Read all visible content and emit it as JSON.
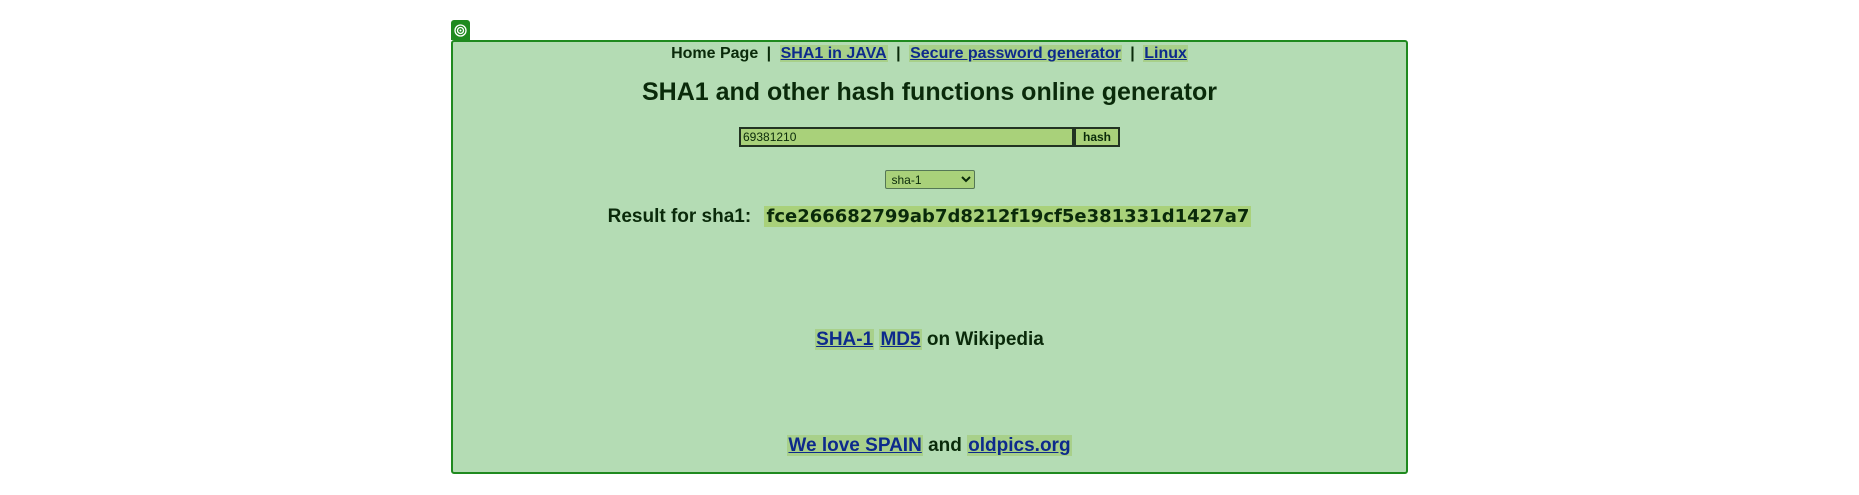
{
  "nav": {
    "home": "Home Page",
    "separator": "|",
    "links": [
      "SHA1 in JAVA",
      "Secure password generator",
      "Linux"
    ]
  },
  "title": "SHA1 and other hash functions online generator",
  "form": {
    "input_value": "69381210",
    "button_label": "hash",
    "algorithm_selected": "sha-1"
  },
  "result": {
    "label": "Result for sha1:",
    "hash": "fce266682799ab7d8212f19cf5e381331d1427a7"
  },
  "wiki": {
    "link1": "SHA-1",
    "link2": "MD5",
    "suffix": "on Wikipedia"
  },
  "footer": {
    "link1": "We love SPAIN",
    "conj": "and",
    "link2": "oldpics.org"
  },
  "colors": {
    "panel_bg": "#b4dcb4",
    "border": "#1f8a1f",
    "highlight": "#a9d17a",
    "link": "#0d2a8c"
  },
  "icons": {
    "corner": "target-icon"
  }
}
